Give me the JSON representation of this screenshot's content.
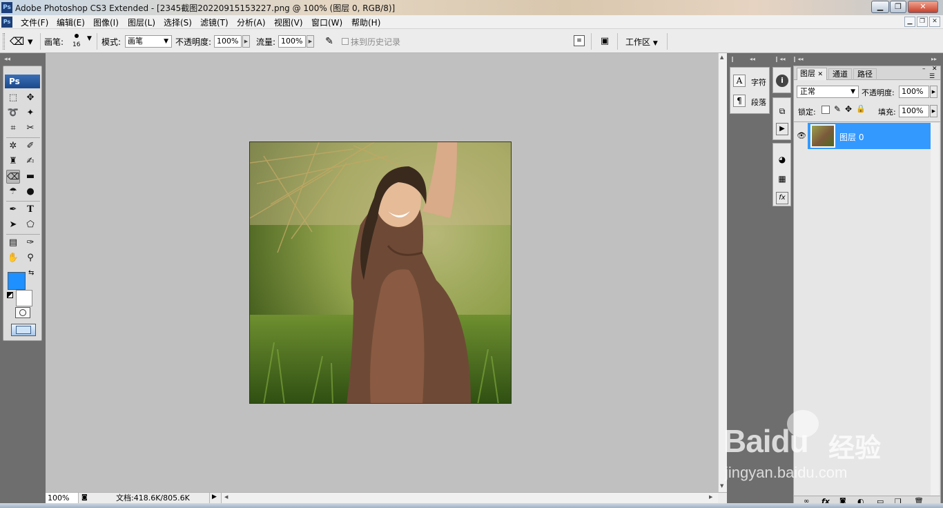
{
  "window": {
    "title": "Adobe Photoshop CS3 Extended - [2345截图20220915153227.png @ 100% (图层 0, RGB/8)]",
    "logo": "Ps"
  },
  "menu": [
    "文件(F)",
    "编辑(E)",
    "图像(I)",
    "图层(L)",
    "选择(S)",
    "滤镜(T)",
    "分析(A)",
    "视图(V)",
    "窗口(W)",
    "帮助(H)"
  ],
  "options": {
    "brush_label": "画笔:",
    "brush_size": "16",
    "mode_label": "模式:",
    "mode_value": "画笔",
    "opacity_label": "不透明度:",
    "opacity_value": "100%",
    "flow_label": "流量:",
    "flow_value": "100%",
    "erase_history": "抹到历史记录",
    "workspace": "工作区"
  },
  "toolbox": {
    "logo": "Ps"
  },
  "status": {
    "zoom": "100%",
    "doc": "文档:418.6K/805.6K"
  },
  "char_panel": {
    "char": "字符",
    "para": "段落"
  },
  "layers_panel": {
    "tabs": [
      "图层",
      "通道",
      "路径"
    ],
    "blend_mode": "正常",
    "opacity_label": "不透明度:",
    "opacity_value": "100%",
    "lock_label": "锁定:",
    "fill_label": "填充:",
    "fill_value": "100%",
    "layer_name": "图层 0"
  },
  "colors": {
    "foreground": "#1e90ff",
    "background": "#ffffff",
    "layer_highlight": "#3399ff"
  },
  "watermark": {
    "brand": "Baidu",
    "brand_cn": "经验",
    "url": "jingyan.baidu.com"
  }
}
